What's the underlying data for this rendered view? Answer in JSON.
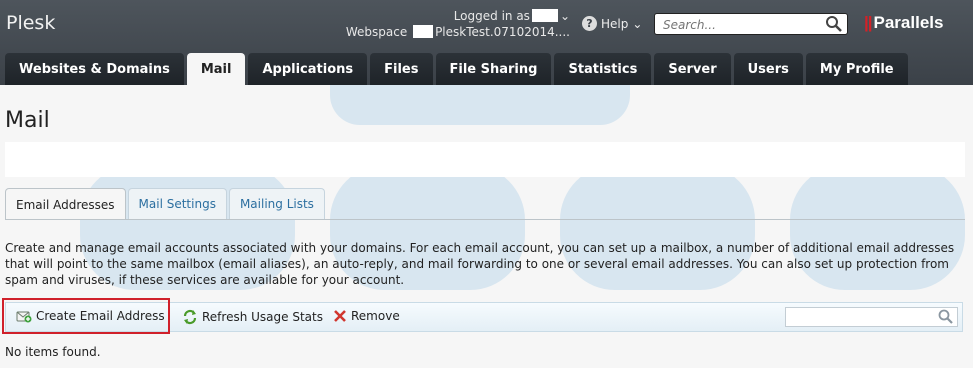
{
  "header": {
    "brand": "Plesk",
    "logged_in_label": "Logged in as",
    "webspace_label": "Webspace",
    "webspace_value": "PleskTest.07102014....",
    "help_label": "Help",
    "search_placeholder": "Search...",
    "partner_logo": "Parallels",
    "icons": {
      "help": "question-circle-icon",
      "search": "magnifier-icon",
      "user_menu": "chevron-down-icon"
    }
  },
  "nav": {
    "tabs": [
      {
        "label": "Websites & Domains"
      },
      {
        "label": "Mail"
      },
      {
        "label": "Applications"
      },
      {
        "label": "Files"
      },
      {
        "label": "File Sharing"
      },
      {
        "label": "Statistics"
      },
      {
        "label": "Server"
      },
      {
        "label": "Users"
      },
      {
        "label": "My Profile"
      }
    ],
    "active": "Mail"
  },
  "main": {
    "title": "Mail",
    "subtabs": [
      {
        "label": "Email Addresses"
      },
      {
        "label": "Mail Settings"
      },
      {
        "label": "Mailing Lists"
      }
    ],
    "active_subtab": "Email Addresses",
    "description": "Create and manage email accounts associated with your domains. For each email account, you can set up a mailbox, a number of additional email addresses that will point to the same mailbox (email aliases), an auto-reply, and mail forwarding to one or several email addresses. You can also set up protection from spam and viruses, if these services are available for your account.",
    "toolbar": {
      "create_label": "Create Email Address",
      "refresh_label": "Refresh Usage Stats",
      "remove_label": "Remove",
      "icons": {
        "create": "add-mail-icon",
        "refresh": "refresh-arrows-icon",
        "remove": "red-x-icon"
      }
    },
    "empty_text": "No items found."
  },
  "colors": {
    "header_bg": "#3b4148",
    "tab_bg": "#1e2328",
    "link": "#2c6fa0",
    "highlight": "#d0202a",
    "toolbar_bg": "#e4eff6"
  }
}
